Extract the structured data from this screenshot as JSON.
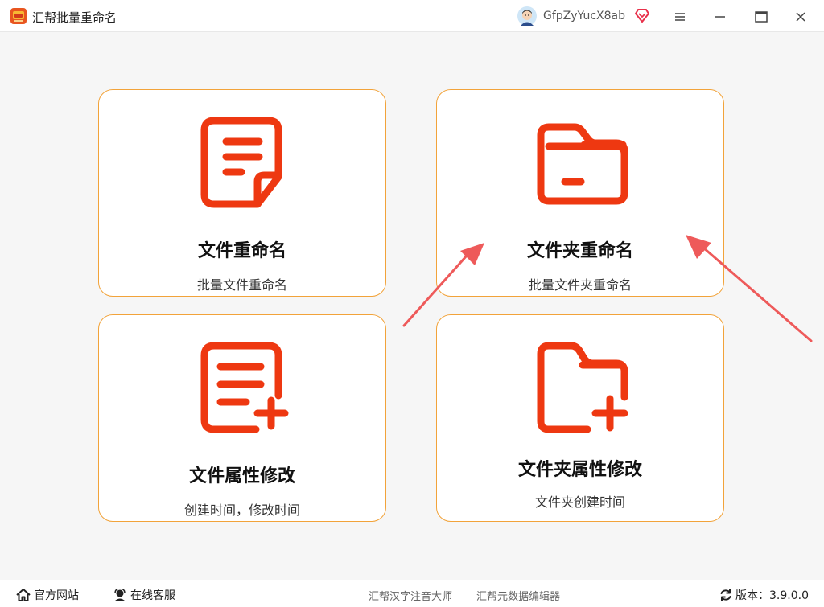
{
  "app": {
    "title": "汇帮批量重命名",
    "username": "GfpZyYucX8ab"
  },
  "colors": {
    "accent": "#ee3811",
    "card_border": "#f2a33a",
    "arrow": "#ee5a5a"
  },
  "cards": [
    {
      "title": "文件重命名",
      "subtitle": "批量文件重命名",
      "icon": "document-icon"
    },
    {
      "title": "文件夹重命名",
      "subtitle": "批量文件夹重命名",
      "icon": "folder-icon"
    },
    {
      "title": "文件属性修改",
      "subtitle": "创建时间，修改时间",
      "icon": "document-add-icon"
    },
    {
      "title": "文件夹属性修改",
      "subtitle": "文件夹创建时间",
      "icon": "folder-add-icon"
    }
  ],
  "footer": {
    "website": "官方网站",
    "support": "在线客服",
    "link1": "汇帮汉字注音大师",
    "link2": "汇帮元数据编辑器",
    "version": "版本：3.9.0.0"
  }
}
